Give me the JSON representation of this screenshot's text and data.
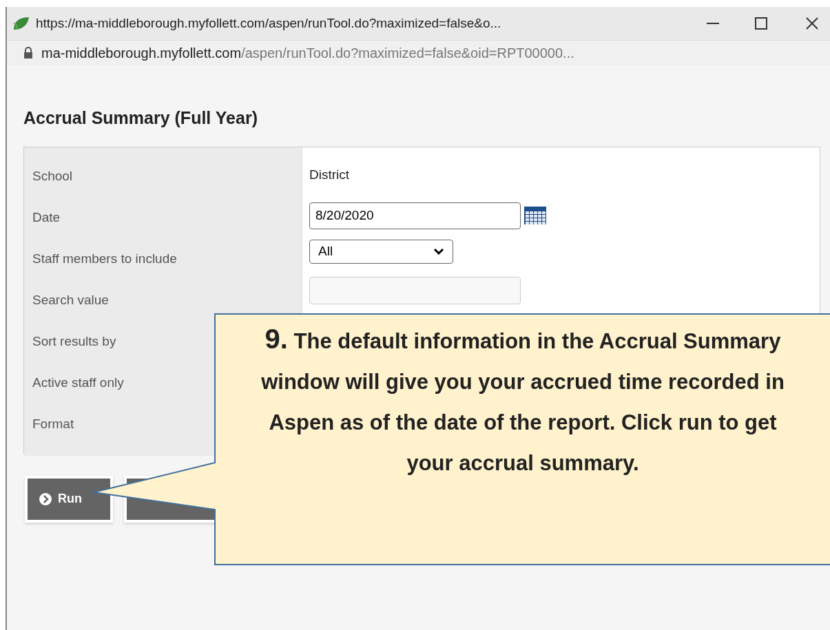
{
  "window": {
    "title": "https://ma-middleborough.myfollett.com/aspen/runTool.do?maximized=false&o...",
    "url_host": "ma-middleborough.myfollett.com",
    "url_path": "/aspen/runTool.do?maximized=false&oid=RPT00000..."
  },
  "page_title": "Accrual Summary (Full Year)",
  "fields": [
    {
      "kind": "text",
      "label": "School",
      "value": "District"
    },
    {
      "kind": "date",
      "label": "Date",
      "value": "8/20/2020"
    },
    {
      "kind": "select",
      "label": "Staff members to include",
      "value": "All"
    },
    {
      "kind": "input",
      "label": "Search value"
    },
    {
      "kind": "hidden",
      "label": "Sort results by"
    },
    {
      "kind": "hidden",
      "label": "Active staff only"
    },
    {
      "kind": "hidden",
      "label": "Format"
    }
  ],
  "buttons": [
    {
      "label": "Run"
    }
  ],
  "callout": {
    "number": "9.",
    "text": "The default information in the Accrual Summary window will give you your accrued time recorded in Aspen as of the date of the report. Click run to get your accrual summary."
  }
}
